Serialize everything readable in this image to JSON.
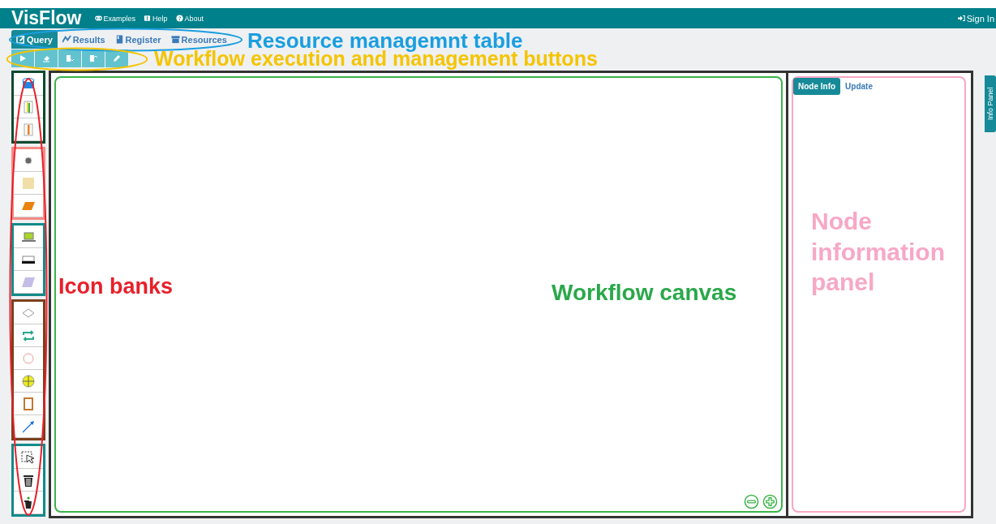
{
  "navbar": {
    "brand": "VisFlow",
    "links": [
      {
        "label": "Examples",
        "kind": "link"
      },
      {
        "label": "Help",
        "kind": "book"
      },
      {
        "label": "About",
        "kind": "question"
      }
    ],
    "sign_in": "Sign In"
  },
  "tabs": [
    {
      "label": "Query",
      "kind": "edit",
      "selected": true
    },
    {
      "label": "Results",
      "kind": "chart",
      "selected": false
    },
    {
      "label": "Register",
      "kind": "file",
      "selected": false
    },
    {
      "label": "Resources",
      "kind": "archive",
      "selected": false
    }
  ],
  "toolbar": [
    {
      "kind": "play"
    },
    {
      "kind": "eraser"
    },
    {
      "kind": "save-down"
    },
    {
      "kind": "save-up"
    },
    {
      "kind": "pencil"
    }
  ],
  "icon_banks": [
    {
      "color": "#0d4a2e",
      "icons": [
        {
          "kind": "database"
        },
        {
          "kind": "bars-green"
        },
        {
          "kind": "bars-orange"
        }
      ]
    },
    {
      "color": "#f58c86",
      "icons": [
        {
          "kind": "dot"
        },
        {
          "kind": "square"
        },
        {
          "kind": "para-orange"
        }
      ]
    },
    {
      "color": "#138a8a",
      "icons": [
        {
          "kind": "laptop"
        },
        {
          "kind": "printer"
        },
        {
          "kind": "para-lavender"
        }
      ]
    },
    {
      "color": "#7a3f1c",
      "icons": [
        {
          "kind": "diamond"
        },
        {
          "kind": "loop"
        },
        {
          "kind": "circle"
        },
        {
          "kind": "crosshair"
        },
        {
          "kind": "frame"
        },
        {
          "kind": "arrow"
        }
      ]
    },
    {
      "color": "#138a8a",
      "icons": [
        {
          "kind": "select"
        },
        {
          "kind": "trash"
        },
        {
          "kind": "user-trash"
        }
      ]
    }
  ],
  "info_panel": {
    "tabs": [
      {
        "label": "Node Info",
        "selected": true
      },
      {
        "label": "Update",
        "selected": false
      }
    ],
    "side_tab": "Info Panel"
  },
  "annotations": [
    {
      "text": "Resource managemnt table",
      "color": "#1a9ee0"
    },
    {
      "text": "Workflow execution and management buttons",
      "color": "#f5c400"
    },
    {
      "text": "Icon banks",
      "color": "#e8202a"
    },
    {
      "text": "Workflow canvas",
      "color": "#2aa84a"
    },
    {
      "text": "Node information panel",
      "color": "#f7a8c4"
    }
  ],
  "highlights": [
    {
      "color": "#1a9ee0"
    },
    {
      "color": "#f5c400"
    },
    {
      "color": "#e8202a"
    }
  ]
}
